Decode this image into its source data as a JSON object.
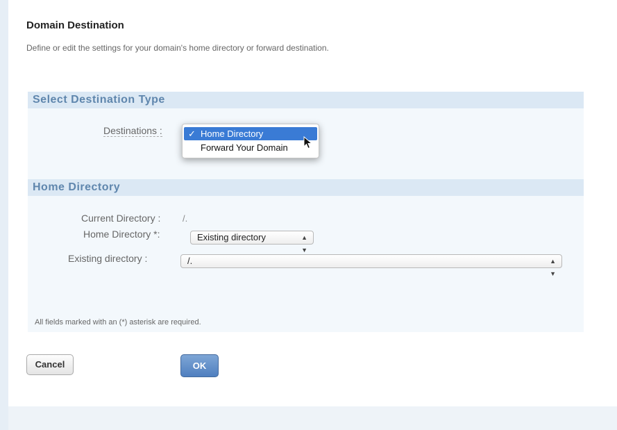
{
  "header": {
    "title": "Domain Destination",
    "description": "Define or edit the settings for your domain's home directory or forward destination."
  },
  "destination_section": {
    "heading": "Select Destination Type",
    "destinations_label": "Destinations :",
    "dropdown": {
      "options": [
        {
          "label": "Home Directory",
          "selected": true,
          "check": "✓"
        },
        {
          "label": "Forward Your Domain",
          "selected": false
        }
      ]
    }
  },
  "home_section": {
    "heading": "Home Directory",
    "current_directory_label": "Current Directory :",
    "current_directory_value": "/.",
    "home_directory_label": "Home Directory *:",
    "home_directory_select": "Existing directory",
    "existing_directory_label": "Existing directory :",
    "existing_directory_select": "/.",
    "required_note": "All fields marked with an (*) asterisk are required."
  },
  "actions": {
    "cancel_label": "Cancel",
    "ok_label": "OK"
  },
  "icons": {
    "select_arrows": "updown-arrows-icon",
    "checkmark": "checkmark-icon",
    "cursor": "mouse-pointer-icon"
  }
}
